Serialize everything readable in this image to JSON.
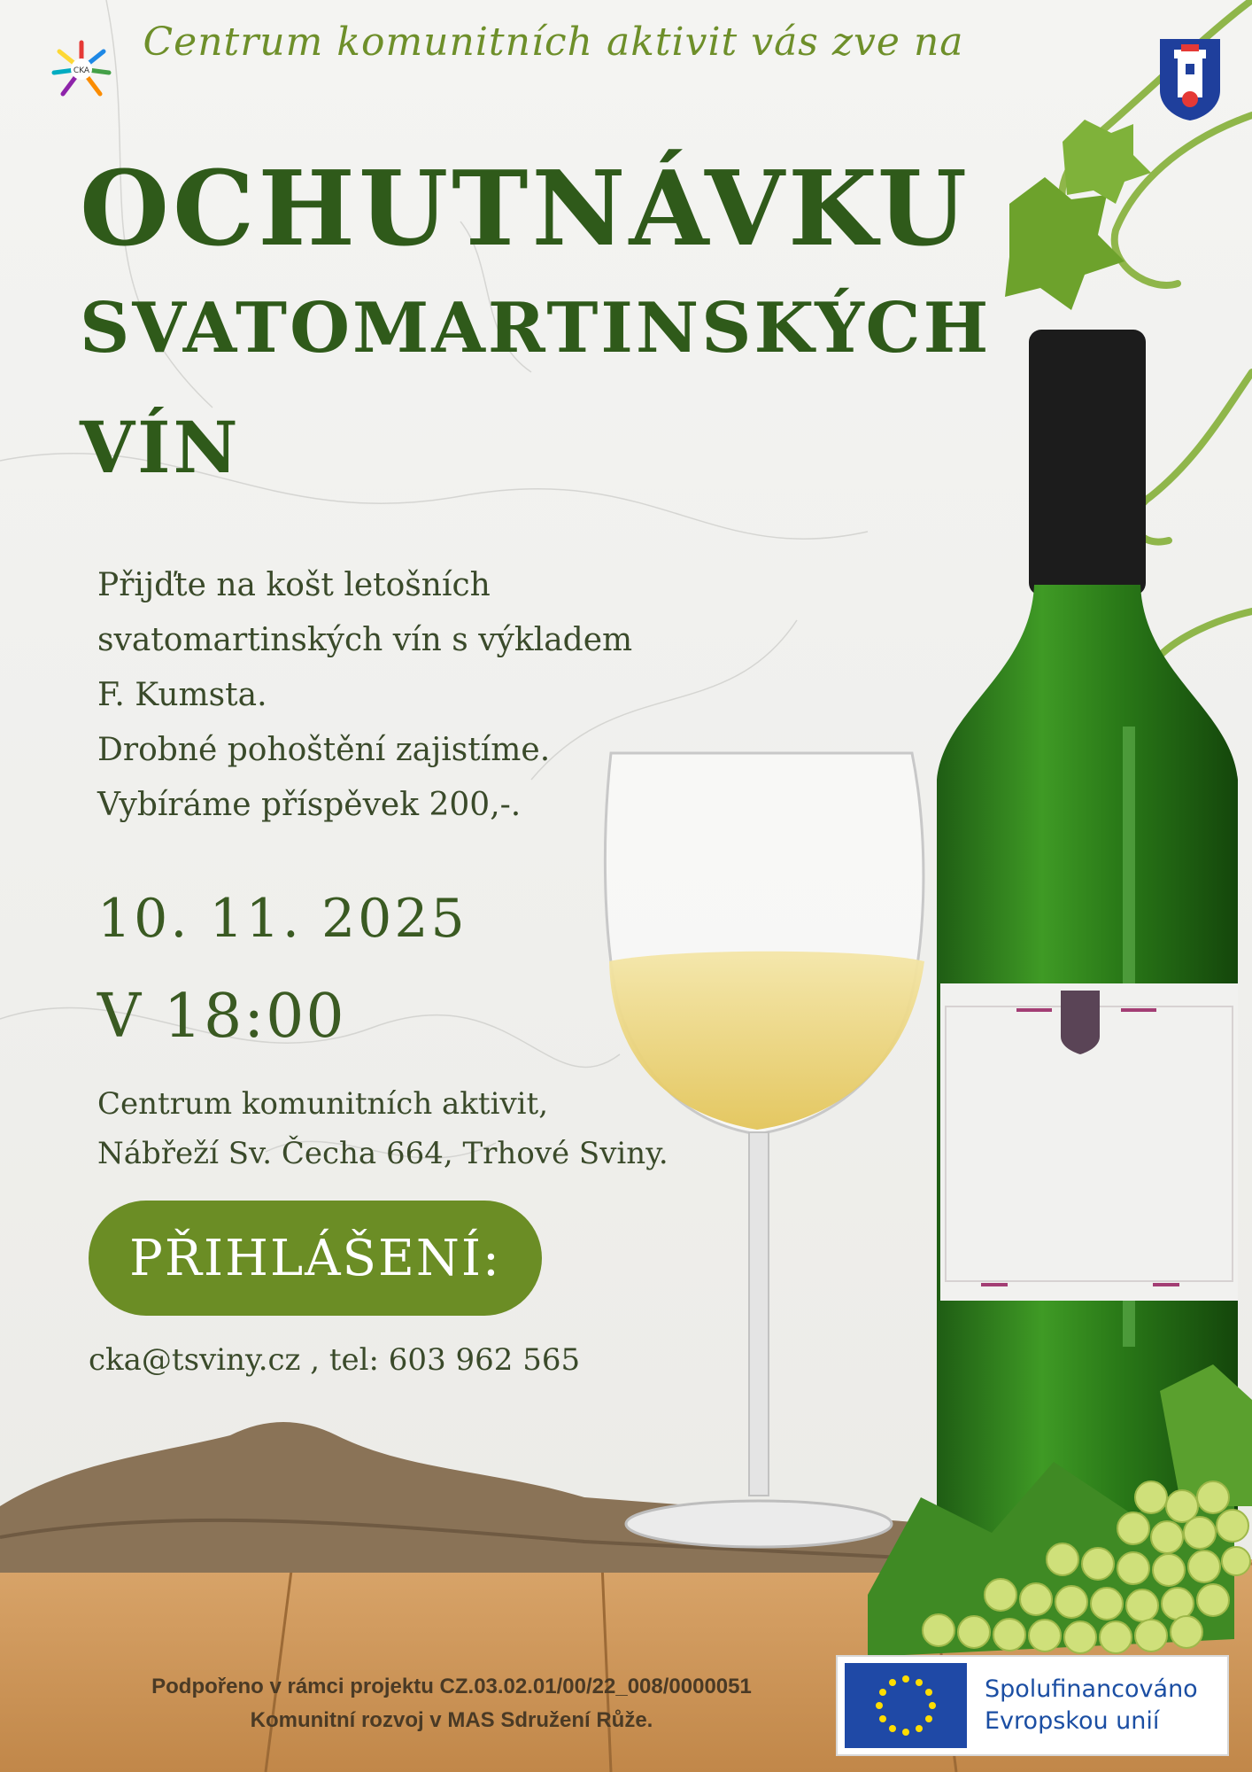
{
  "header": {
    "invite_line": "Centrum komunitních aktivit vás zve na"
  },
  "title": {
    "line1": "OCHUTNÁVKU",
    "line2": "SVATOMARTINSKÝCH",
    "line3": "VÍN"
  },
  "description": {
    "lines": [
      "Přijďte na košt letošních",
      "svatomartinských vín s výkladem",
      "F. Kumsta.",
      "Drobné pohoštění zajistíme.",
      "Vybíráme příspěvek 200,-."
    ]
  },
  "event": {
    "date": "10. 11. 2025",
    "time": "V 18:00",
    "place_line1": "Centrum komunitních aktivit,",
    "place_line2": "Nábřeží Sv. Čecha 664, Trhové Sviny."
  },
  "registration": {
    "button_label": "PŘIHLÁŠENÍ:",
    "contact": "cka@tsviny.cz , tel: 603 962 565"
  },
  "footer": {
    "line1": "Podpořeno v rámci projektu CZ.03.02.01/00/22_008/0000051",
    "line2": "Komunitní rozvoj v MAS Sdružení Růže.",
    "eu_line1": "Spolufinancováno",
    "eu_line2": "Evropskou unií"
  },
  "logos": {
    "left_logo_text": "CKA",
    "crest_icon": "town-crest-icon",
    "eu_flag_icon": "eu-flag-icon"
  },
  "colors": {
    "title_green": "#2f5a1a",
    "accent_green": "#6b8d25",
    "invite_green": "#6e8f2a",
    "eu_blue": "#1b4ea3"
  }
}
